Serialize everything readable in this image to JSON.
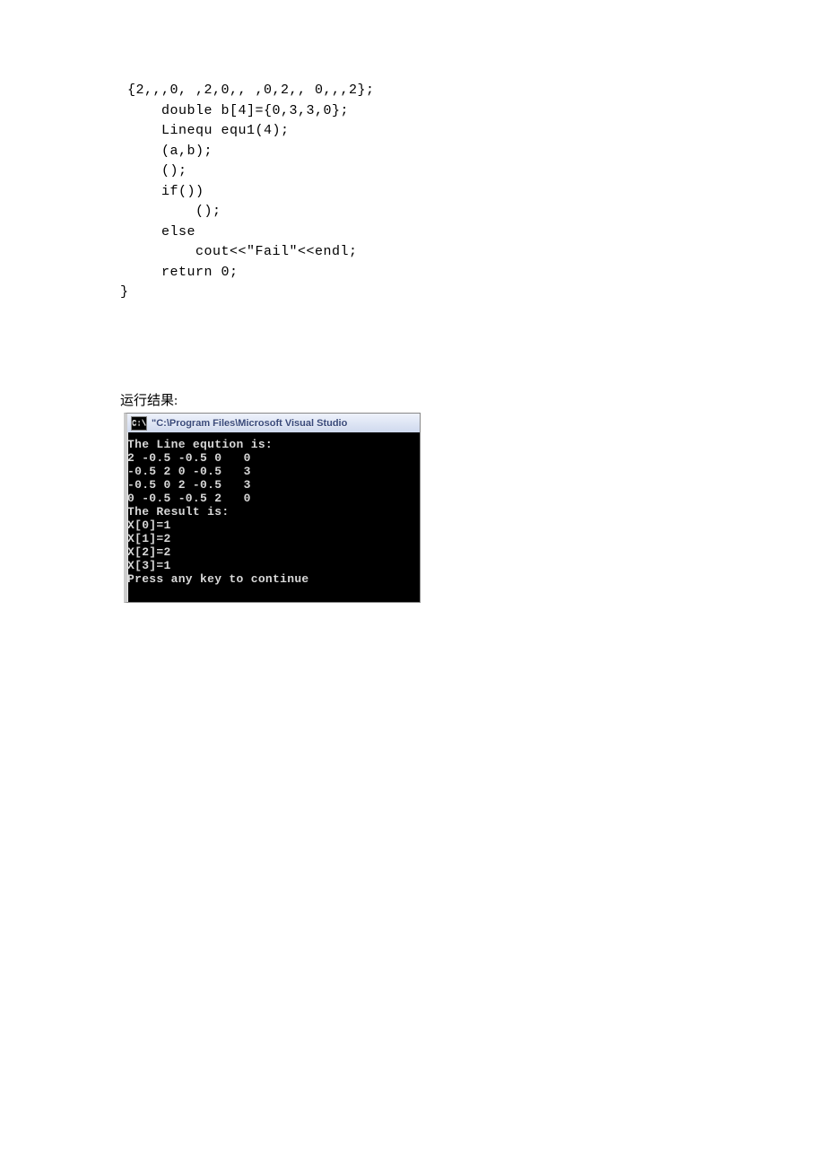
{
  "code_lines": [
    "{2,,,0, ,2,0,, ,0,2,, 0,,,2};",
    "    double b[4]={0,3,3,0};",
    "    Linequ equ1(4);",
    "    (a,b);",
    "    ();",
    "    if())",
    "        ();",
    "    else",
    "        cout<<\"Fail\"<<endl;",
    "    return 0;"
  ],
  "close_brace": "}",
  "result_label": "运行结果:",
  "console": {
    "icon": "C:\\",
    "title": "\"C:\\Program Files\\Microsoft Visual Studio",
    "lines": [
      "The Line eqution is:",
      "2 -0.5 -0.5 0   0",
      "-0.5 2 0 -0.5   3",
      "-0.5 0 2 -0.5   3",
      "0 -0.5 -0.5 2   0",
      "The Result is:",
      "X[0]=1",
      "X[1]=2",
      "X[2]=2",
      "X[3]=1",
      "Press any key to continue"
    ]
  },
  "chart_data": {
    "type": "table",
    "title": "Linear Equation System Output",
    "matrix": [
      [
        2,
        -0.5,
        -0.5,
        0,
        0
      ],
      [
        -0.5,
        2,
        0,
        -0.5,
        3
      ],
      [
        -0.5,
        0,
        2,
        -0.5,
        3
      ],
      [
        0,
        -0.5,
        -0.5,
        2,
        0
      ]
    ],
    "solution": {
      "X[0]": 1,
      "X[1]": 2,
      "X[2]": 2,
      "X[3]": 1
    }
  }
}
